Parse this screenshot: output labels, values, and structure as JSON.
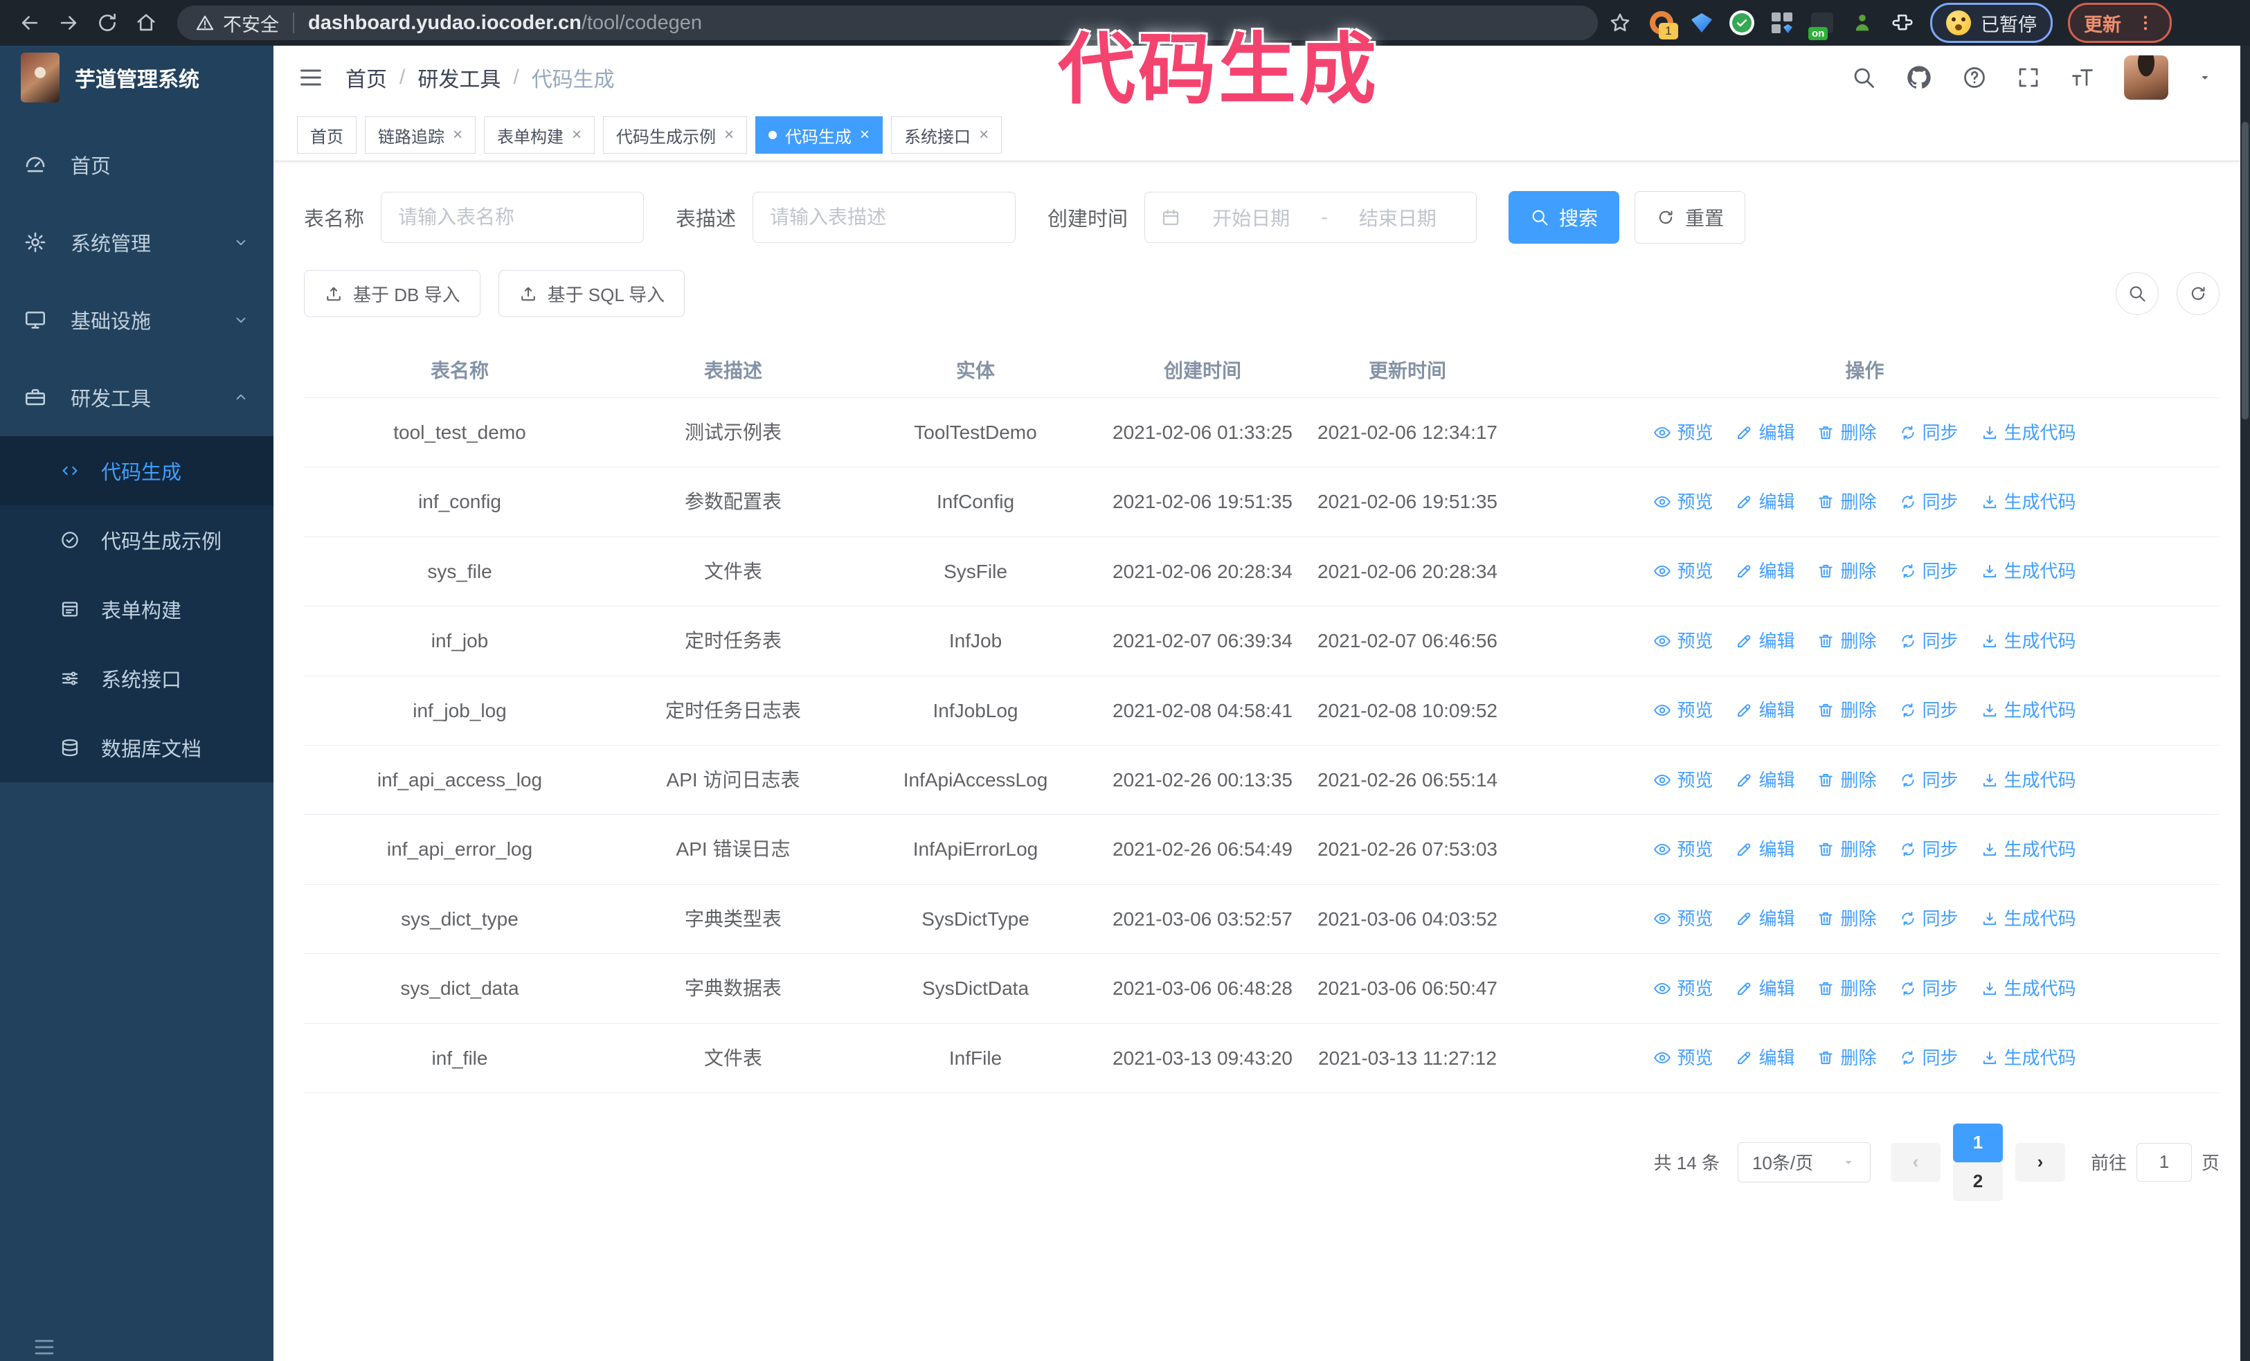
{
  "browser": {
    "security_label": "不安全",
    "url_host": "dashboard.yudao.iocoder.cn",
    "url_path": "/tool/codegen",
    "extension_badge": "1",
    "extension_on_label": "on",
    "paused_chip_label": "已暂停",
    "update_button_label": "更新"
  },
  "annotation": {
    "text": "代码生成",
    "color": "#f4436f"
  },
  "sidebar": {
    "app_title": "芋道管理系统",
    "menu": [
      {
        "label": "首页",
        "icon": "home",
        "chevron": "none"
      },
      {
        "label": "系统管理",
        "icon": "gear",
        "chevron": "down"
      },
      {
        "label": "基础设施",
        "icon": "monitor",
        "chevron": "down"
      },
      {
        "label": "研发工具",
        "icon": "toolbox",
        "chevron": "up"
      }
    ],
    "submenu": [
      {
        "label": "代码生成",
        "icon": "code",
        "active": true
      },
      {
        "label": "代码生成示例",
        "icon": "example",
        "active": false
      },
      {
        "label": "表单构建",
        "icon": "form",
        "active": false
      },
      {
        "label": "系统接口",
        "icon": "api",
        "active": false
      },
      {
        "label": "数据库文档",
        "icon": "dbdoc",
        "active": false
      }
    ]
  },
  "header": {
    "breadcrumb": [
      "首页",
      "研发工具",
      "代码生成"
    ],
    "breadcrumb_separator": "/"
  },
  "tabs": [
    {
      "label": "首页",
      "closable": false,
      "active": false
    },
    {
      "label": "链路追踪",
      "closable": true,
      "active": false
    },
    {
      "label": "表单构建",
      "closable": true,
      "active": false
    },
    {
      "label": "代码生成示例",
      "closable": true,
      "active": false
    },
    {
      "label": "代码生成",
      "closable": true,
      "active": true
    },
    {
      "label": "系统接口",
      "closable": true,
      "active": false
    }
  ],
  "filters": {
    "table_name_label": "表名称",
    "table_name_placeholder": "请输入表名称",
    "table_desc_label": "表描述",
    "table_desc_placeholder": "请输入表描述",
    "create_time_label": "创建时间",
    "date_start_placeholder": "开始日期",
    "date_separator": "-",
    "date_end_placeholder": "结束日期",
    "search_button": "搜索",
    "reset_button": "重置"
  },
  "toolbar": {
    "import_db_button": "基于 DB 导入",
    "import_sql_button": "基于 SQL 导入"
  },
  "table": {
    "columns": [
      "表名称",
      "表描述",
      "实体",
      "创建时间",
      "更新时间",
      "操作"
    ],
    "actions": [
      "预览",
      "编辑",
      "删除",
      "同步",
      "生成代码"
    ],
    "rows": [
      {
        "name": "tool_test_demo",
        "desc": "测试示例表",
        "entity": "ToolTestDemo",
        "created": "2021-02-06 01:33:25",
        "updated": "2021-02-06 12:34:17"
      },
      {
        "name": "inf_config",
        "desc": "参数配置表",
        "entity": "InfConfig",
        "created": "2021-02-06 19:51:35",
        "updated": "2021-02-06 19:51:35"
      },
      {
        "name": "sys_file",
        "desc": "文件表",
        "entity": "SysFile",
        "created": "2021-02-06 20:28:34",
        "updated": "2021-02-06 20:28:34"
      },
      {
        "name": "inf_job",
        "desc": "定时任务表",
        "entity": "InfJob",
        "created": "2021-02-07 06:39:34",
        "updated": "2021-02-07 06:46:56"
      },
      {
        "name": "inf_job_log",
        "desc": "定时任务日志表",
        "entity": "InfJobLog",
        "created": "2021-02-08 04:58:41",
        "updated": "2021-02-08 10:09:52"
      },
      {
        "name": "inf_api_access_log",
        "desc": "API 访问日志表",
        "entity": "InfApiAccessLog",
        "created": "2021-02-26 00:13:35",
        "updated": "2021-02-26 06:55:14"
      },
      {
        "name": "inf_api_error_log",
        "desc": "API 错误日志",
        "entity": "InfApiErrorLog",
        "created": "2021-02-26 06:54:49",
        "updated": "2021-02-26 07:53:03"
      },
      {
        "name": "sys_dict_type",
        "desc": "字典类型表",
        "entity": "SysDictType",
        "created": "2021-03-06 03:52:57",
        "updated": "2021-03-06 04:03:52"
      },
      {
        "name": "sys_dict_data",
        "desc": "字典数据表",
        "entity": "SysDictData",
        "created": "2021-03-06 06:48:28",
        "updated": "2021-03-06 06:50:47"
      },
      {
        "name": "inf_file",
        "desc": "文件表",
        "entity": "InfFile",
        "created": "2021-03-13 09:43:20",
        "updated": "2021-03-13 11:27:12"
      }
    ]
  },
  "pagination": {
    "total_text": "共 14 条",
    "page_size_value": "10条/页",
    "pages": [
      "1",
      "2"
    ],
    "active_page": "1",
    "prev_glyph": "‹",
    "next_glyph": "›",
    "goto_label": "前往",
    "goto_value": "1",
    "goto_unit": "页"
  },
  "glyphs": {
    "close": "×"
  },
  "icon_names": [
    "back",
    "forward",
    "reload",
    "home",
    "warning-triangle",
    "bookmark-star",
    "extensions-puzzle",
    "kebab-dots",
    "emoji-face",
    "search",
    "github",
    "help",
    "fullscreen",
    "font-size",
    "caret-down",
    "hamburger",
    "chevron-down",
    "chevron-up",
    "dashboard",
    "gear",
    "monitor",
    "toolbox",
    "code",
    "shield-check",
    "form",
    "api-list",
    "database",
    "calendar",
    "upload",
    "eye",
    "pencil",
    "trash",
    "sync",
    "download",
    "refresh",
    "magnifier"
  ],
  "colors": {
    "accent": "#409eff",
    "chrome_bg": "#1e242c",
    "omnibox_bg": "#343b45",
    "sidebar_bg": "#22415d",
    "submenu_bg": "#16304a",
    "annotation_pink": "#f4436f",
    "paused_chip_border": "#7da7f8",
    "update_chip_border": "#d4604a",
    "table_header_text": "#8492a6",
    "table_cell_text": "#606266"
  }
}
